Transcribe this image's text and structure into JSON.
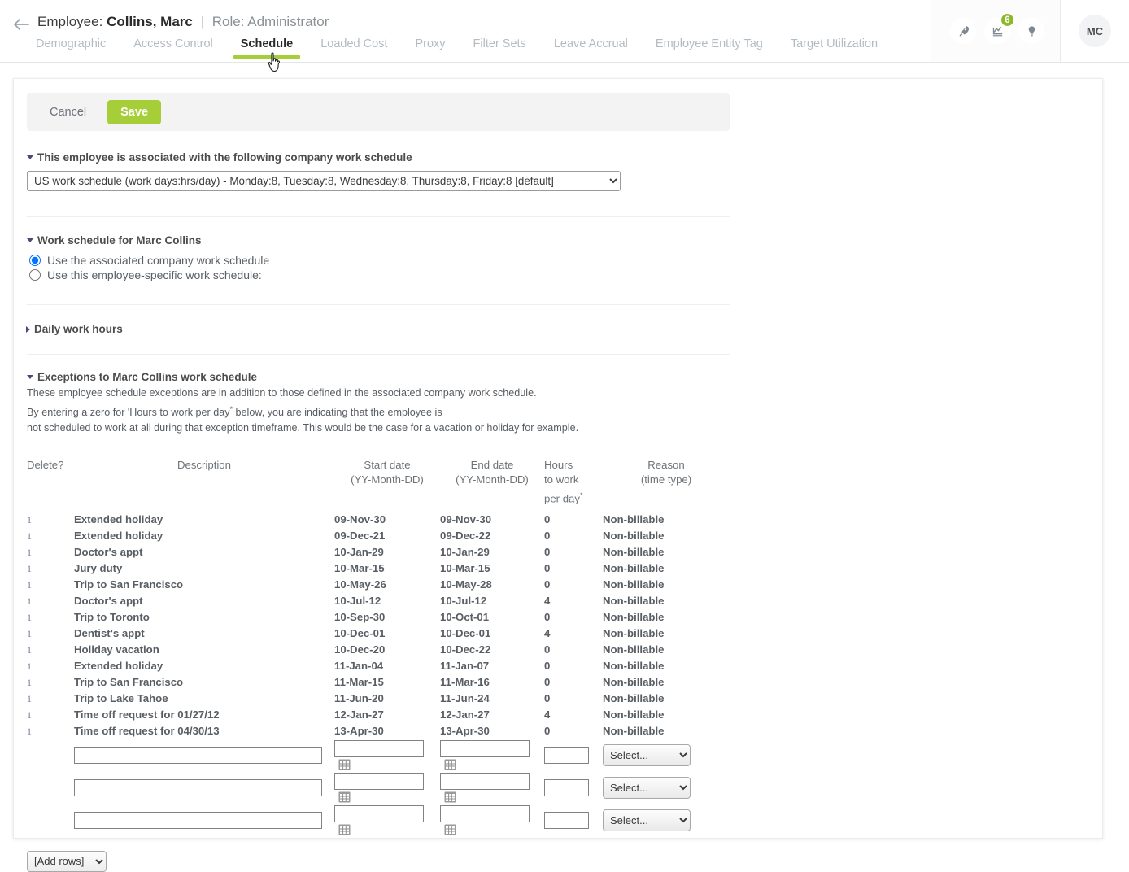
{
  "header": {
    "back_icon": "back-arrow-icon",
    "employee_label": "Employee:",
    "employee_name": "Collins, Marc",
    "separator": "|",
    "role_text": "Role: Administrator",
    "tabs": [
      {
        "label": "Demographic",
        "active": false
      },
      {
        "label": "Access Control",
        "active": false
      },
      {
        "label": "Schedule",
        "active": true
      },
      {
        "label": "Loaded Cost",
        "active": false
      },
      {
        "label": "Proxy",
        "active": false
      },
      {
        "label": "Filter Sets",
        "active": false
      },
      {
        "label": "Leave Accrual",
        "active": false
      },
      {
        "label": "Employee Entity Tag",
        "active": false
      },
      {
        "label": "Target Utilization",
        "active": false
      }
    ],
    "icons": [
      {
        "name": "rocket-icon",
        "badge": ""
      },
      {
        "name": "approvals-icon",
        "badge": "6"
      },
      {
        "name": "lightbulb-icon",
        "badge": ""
      }
    ],
    "avatar_initials": "MC",
    "accent_color": "#a6ce39",
    "badge_color": "#8cb82b"
  },
  "toolbar": {
    "cancel_label": "Cancel",
    "save_label": "Save"
  },
  "company_schedule": {
    "heading": "This employee is associated with the following company work schedule",
    "selected": "US work schedule (work days:hrs/day) - Monday:8, Tuesday:8, Wednesday:8, Thursday:8, Friday:8 [default]"
  },
  "work_schedule": {
    "heading": "Work schedule for Marc Collins",
    "option_company": "Use the associated company work schedule",
    "option_specific": "Use this employee-specific work schedule:"
  },
  "daily_work_hours": {
    "heading": "Daily work hours"
  },
  "exceptions": {
    "heading": "Exceptions to Marc Collins work schedule",
    "desc_line1": "These employee schedule exceptions are in addition to those defined in the associated company work schedule.",
    "desc_line2_a": "By entering a zero for 'Hours to work per day",
    "desc_line2_star": "*",
    "desc_line2_b": " below, you are indicating that the employee is",
    "desc_line3": "not scheduled to work at all during that exception timeframe. This would be the case for a vacation or holiday for example.",
    "columns": {
      "delete": "Delete?",
      "description": "Description",
      "start_date": "Start date",
      "start_date_fmt": "(YY-Month-DD)",
      "end_date": "End date",
      "end_date_fmt": "(YY-Month-DD)",
      "hours_l1": "Hours",
      "hours_l2": "to work",
      "hours_l3": "per day",
      "hours_star": "*",
      "reason": "Reason",
      "reason_sub": "(time type)"
    },
    "rows": [
      {
        "delete": "1",
        "description": "Extended holiday",
        "start": "09-Nov-30",
        "end": "09-Nov-30",
        "hours": "0",
        "reason": "Non-billable"
      },
      {
        "delete": "1",
        "description": "Extended holiday",
        "start": "09-Dec-21",
        "end": "09-Dec-22",
        "hours": "0",
        "reason": "Non-billable"
      },
      {
        "delete": "1",
        "description": "Doctor's appt",
        "start": "10-Jan-29",
        "end": "10-Jan-29",
        "hours": "0",
        "reason": "Non-billable"
      },
      {
        "delete": "1",
        "description": "Jury duty",
        "start": "10-Mar-15",
        "end": "10-Mar-15",
        "hours": "0",
        "reason": "Non-billable"
      },
      {
        "delete": "1",
        "description": "Trip to San Francisco",
        "start": "10-May-26",
        "end": "10-May-28",
        "hours": "0",
        "reason": "Non-billable"
      },
      {
        "delete": "1",
        "description": "Doctor's appt",
        "start": "10-Jul-12",
        "end": "10-Jul-12",
        "hours": "4",
        "reason": "Non-billable"
      },
      {
        "delete": "1",
        "description": "Trip to Toronto",
        "start": "10-Sep-30",
        "end": "10-Oct-01",
        "hours": "0",
        "reason": "Non-billable"
      },
      {
        "delete": "1",
        "description": "Dentist's appt",
        "start": "10-Dec-01",
        "end": "10-Dec-01",
        "hours": "4",
        "reason": "Non-billable"
      },
      {
        "delete": "1",
        "description": "Holiday vacation",
        "start": "10-Dec-20",
        "end": "10-Dec-22",
        "hours": "0",
        "reason": "Non-billable"
      },
      {
        "delete": "1",
        "description": "Extended holiday",
        "start": "11-Jan-04",
        "end": "11-Jan-07",
        "hours": "0",
        "reason": "Non-billable"
      },
      {
        "delete": "1",
        "description": "Trip to San Francisco",
        "start": "11-Mar-15",
        "end": "11-Mar-16",
        "hours": "0",
        "reason": "Non-billable"
      },
      {
        "delete": "1",
        "description": "Trip to Lake Tahoe",
        "start": "11-Jun-20",
        "end": "11-Jun-24",
        "hours": "0",
        "reason": "Non-billable"
      },
      {
        "delete": "1",
        "description": "Time off request for 01/27/12",
        "start": "12-Jan-27",
        "end": "12-Jan-27",
        "hours": "4",
        "reason": "Non-billable"
      },
      {
        "delete": "1",
        "description": "Time off request for 04/30/13",
        "start": "13-Apr-30",
        "end": "13-Apr-30",
        "hours": "0",
        "reason": "Non-billable"
      }
    ],
    "entry_rows": [
      {
        "description": "",
        "start": "",
        "end": "",
        "hours": "",
        "reason": "Select..."
      },
      {
        "description": "",
        "start": "",
        "end": "",
        "hours": "",
        "reason": "Select..."
      },
      {
        "description": "",
        "start": "",
        "end": "",
        "hours": "",
        "reason": "Select..."
      }
    ],
    "calendar_icon": "calendar-icon",
    "add_rows_label": "[Add rows]"
  }
}
